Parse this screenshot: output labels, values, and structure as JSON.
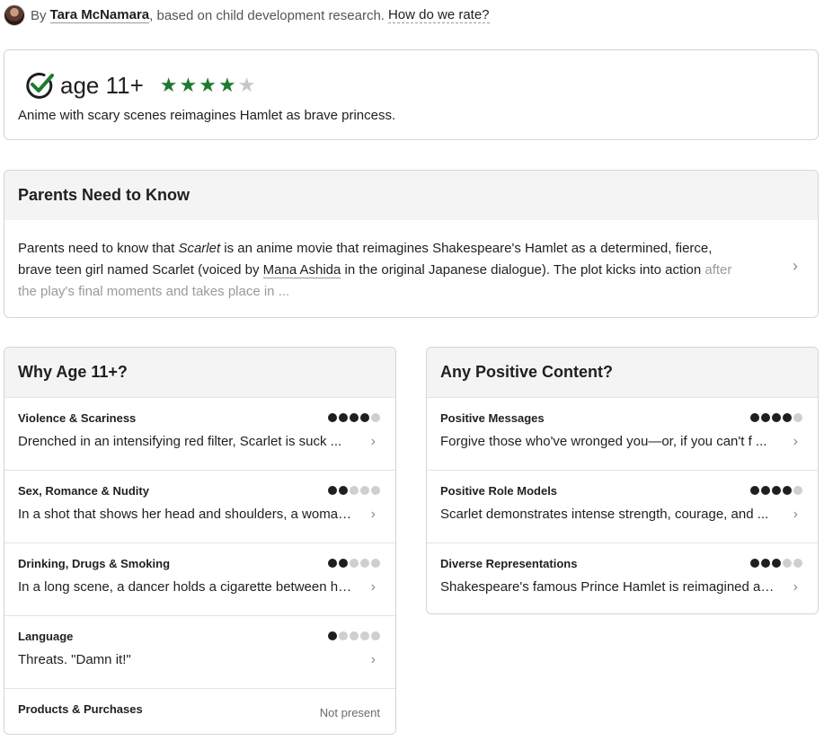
{
  "byline": {
    "prefix": "By",
    "author": "Tara McNamara",
    "suffix": ", based on child development research.",
    "how_link": "How do we rate?"
  },
  "age_rating": {
    "label": "age 11+",
    "stars": 4,
    "max_stars": 5,
    "summary": "Anime with scary scenes reimagines Hamlet as brave princess."
  },
  "parents_need_to_know": {
    "title": "Parents Need to Know",
    "text_1": "Parents need to know that ",
    "title_italic": "Scarlet",
    "text_2": " is an anime movie that reimagines Shakespeare's Hamlet as a determined, fierce, brave teen girl named Scarlet (voiced by ",
    "actor_link": "Mana Ashida",
    "text_3": " in the original Japanese dialogue). The plot kicks into action ",
    "text_fade": "after the play's final moments and takes place in ..."
  },
  "why_age": {
    "title": "Why Age 11+?",
    "rows": [
      {
        "title": "Violence & Scariness",
        "level": 4,
        "text": "Drenched in an intensifying red filter, Scarlet is suck ..."
      },
      {
        "title": "Sex, Romance & Nudity",
        "level": 2,
        "text": "In a shot that shows her head and shoulders, a woman ..."
      },
      {
        "title": "Drinking, Drugs & Smoking",
        "level": 2,
        "text": "In a long scene, a dancer holds a cigarette between h ..."
      },
      {
        "title": "Language",
        "level": 1,
        "text": "Threats. \"Damn it!\""
      },
      {
        "title": "Products & Purchases",
        "status": "Not present"
      }
    ]
  },
  "positive_content": {
    "title": "Any Positive Content?",
    "rows": [
      {
        "title": "Positive Messages",
        "level": 4,
        "text": "Forgive those who've wronged you—or, if you can't f ..."
      },
      {
        "title": "Positive Role Models",
        "level": 4,
        "text": "Scarlet demonstrates intense strength, courage, and ..."
      },
      {
        "title": "Diverse Representations",
        "level": 3,
        "text": "Shakespeare's famous Prince Hamlet is reimagined a ..."
      }
    ]
  },
  "colors": {
    "star_on": "#1d7a2e",
    "star_off": "#c7c7c7",
    "dot_on": "#1f1f1f",
    "dot_off": "#cfcfcf"
  }
}
